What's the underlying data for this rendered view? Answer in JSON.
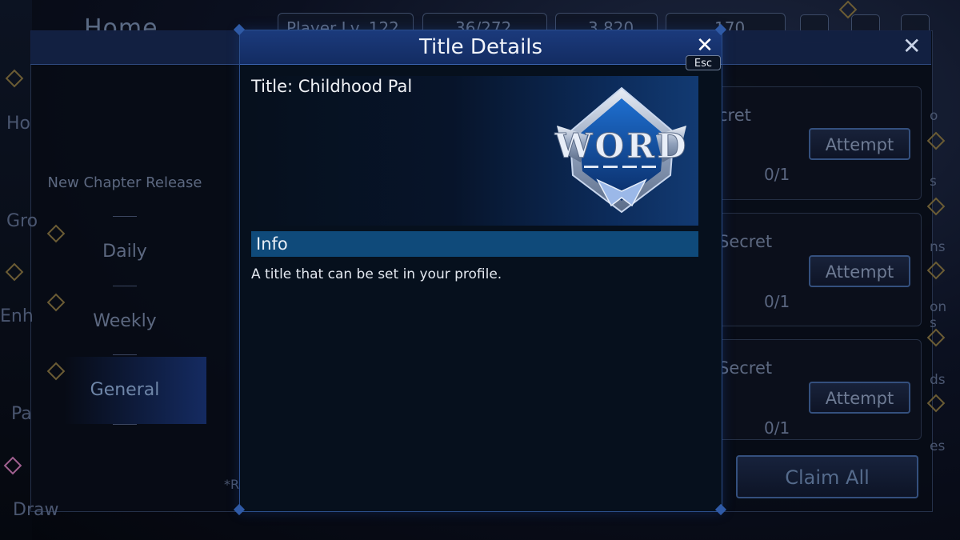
{
  "background": {
    "home_label": "Home",
    "player_level": "Player Lv. 122",
    "ap": "36/272",
    "gems": "3,820",
    "red_gems": "170",
    "side_nav": {
      "new_chapter": "New Chapter Release",
      "daily": "Daily",
      "weekly": "Weekly",
      "general": "General"
    },
    "left_edge": [
      "Ho",
      "Gro",
      "Enh",
      "Pa",
      "Draw"
    ],
    "missions": [
      {
        "title": "cret",
        "button": "Attempt",
        "count": "0/1"
      },
      {
        "title": "Secret",
        "button": "Attempt",
        "count": "0/1"
      },
      {
        "title": "Secret",
        "button": "Attempt",
        "count": "0/1"
      }
    ],
    "claim_all": "Claim All",
    "right_edge": [
      "o",
      "s",
      "ns",
      "on",
      "s",
      "ds",
      "es"
    ],
    "footnote": "*R"
  },
  "modal": {
    "title": "Title Details",
    "close_hint": "Esc",
    "title_line": "Title: Childhood Pal",
    "badge_text": "WORD",
    "info_header": "Info",
    "info_text": "A title that can be set in your profile."
  },
  "colors": {
    "modal_header": "#1b3a7c",
    "info_bar": "#0f4a7a",
    "accent_gold": "#8a7440"
  }
}
